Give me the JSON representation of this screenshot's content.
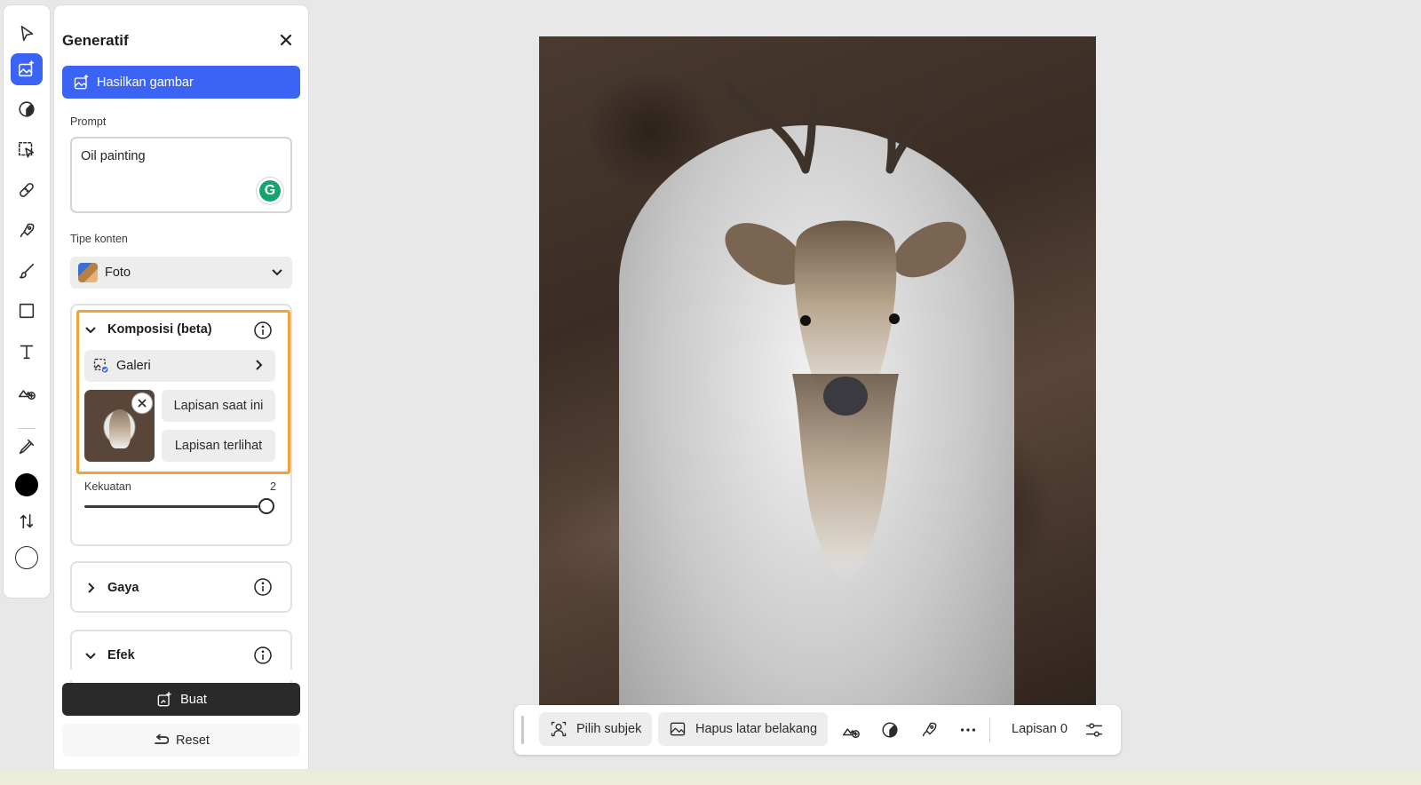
{
  "rail": {
    "tools": [
      {
        "name": "select-tool",
        "icon": "arrow-pointer-icon"
      },
      {
        "name": "generate-tool",
        "icon": "generate-image-icon",
        "active": true
      },
      {
        "name": "adjust-tool",
        "icon": "contrast-icon"
      },
      {
        "name": "select-area-tool",
        "icon": "selection-icon"
      },
      {
        "name": "heal-tool",
        "icon": "bandage-icon"
      },
      {
        "name": "quick-actions-tool",
        "icon": "rocket-icon"
      },
      {
        "name": "brush-tool",
        "icon": "brush-icon"
      },
      {
        "name": "shape-tool",
        "icon": "square-icon"
      },
      {
        "name": "text-tool",
        "icon": "text-icon"
      },
      {
        "name": "add-image-tool",
        "icon": "add-image-icon"
      },
      {
        "name": "eyedropper-tool",
        "icon": "eyedropper-icon"
      },
      {
        "name": "foreground-color",
        "icon": "color-swatch-icon"
      },
      {
        "name": "swap-colors",
        "icon": "swap-icon"
      },
      {
        "name": "background-color",
        "icon": "color-swatch-icon"
      }
    ]
  },
  "panel": {
    "title": "Generatif",
    "primary_button": "Hasilkan gambar",
    "prompt_label": "Prompt",
    "prompt_value": "Oil painting",
    "content_type_label": "Tipe konten",
    "content_type_value": "Foto",
    "composition": {
      "title": "Komposisi (beta)",
      "gallery_label": "Galeri",
      "current_layer": "Lapisan saat ini",
      "visible_layer": "Lapisan terlihat",
      "strength_label": "Kekuatan",
      "strength_value": "2",
      "strength_fraction": 1.0
    },
    "style_section": "Gaya",
    "effects_section": "Efek",
    "generate_button": "Buat",
    "reset_button": "Reset"
  },
  "taskbar": {
    "select_subject": "Pilih subjek",
    "remove_background": "Hapus latar belakang",
    "layer_label": "Lapisan 0"
  },
  "colors": {
    "accent": "#3b63f4",
    "highlight": "#f0a23c",
    "foreground": "#000000",
    "background": "#ffffff"
  }
}
